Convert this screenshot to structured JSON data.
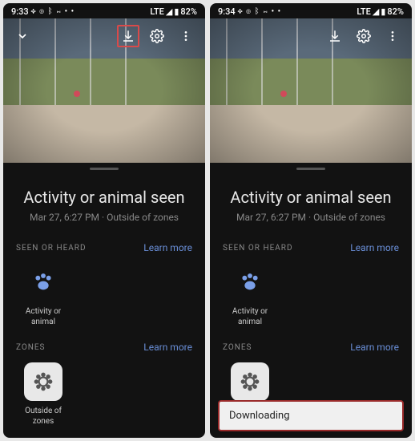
{
  "left": {
    "status": {
      "time": "9:33",
      "icons": "✥ ◎ ᛒ ⋈ • •",
      "net": "LTE",
      "signal": "◢",
      "battery_icon": "▮",
      "battery": "82%"
    },
    "event": {
      "title": "Activity or animal seen",
      "subtitle": "Mar 27, 6:27 PM · Outside of zones"
    },
    "sections": {
      "seen": {
        "label": "SEEN OR HEARD",
        "learn": "Learn more",
        "items": [
          {
            "label": "Activity or animal"
          }
        ]
      },
      "zones": {
        "label": "ZONES",
        "learn": "Learn more",
        "items": [
          {
            "label": "Outside of zones"
          }
        ]
      }
    },
    "highlight": "download"
  },
  "right": {
    "status": {
      "time": "9:34",
      "icons": "✥ ◎ ᛒ ⋈ • •",
      "net": "LTE",
      "signal": "◢",
      "battery_icon": "▮",
      "battery": "82%"
    },
    "event": {
      "title": "Activity or animal seen",
      "subtitle": "Mar 27, 6:27 PM · Outside of zones"
    },
    "sections": {
      "seen": {
        "label": "SEEN OR HEARD",
        "learn": "Learn more",
        "items": [
          {
            "label": "Activity or animal"
          }
        ]
      },
      "zones": {
        "label": "ZONES",
        "learn": "Learn more",
        "items": [
          {
            "label": ""
          }
        ]
      }
    },
    "toast": "Downloading"
  }
}
